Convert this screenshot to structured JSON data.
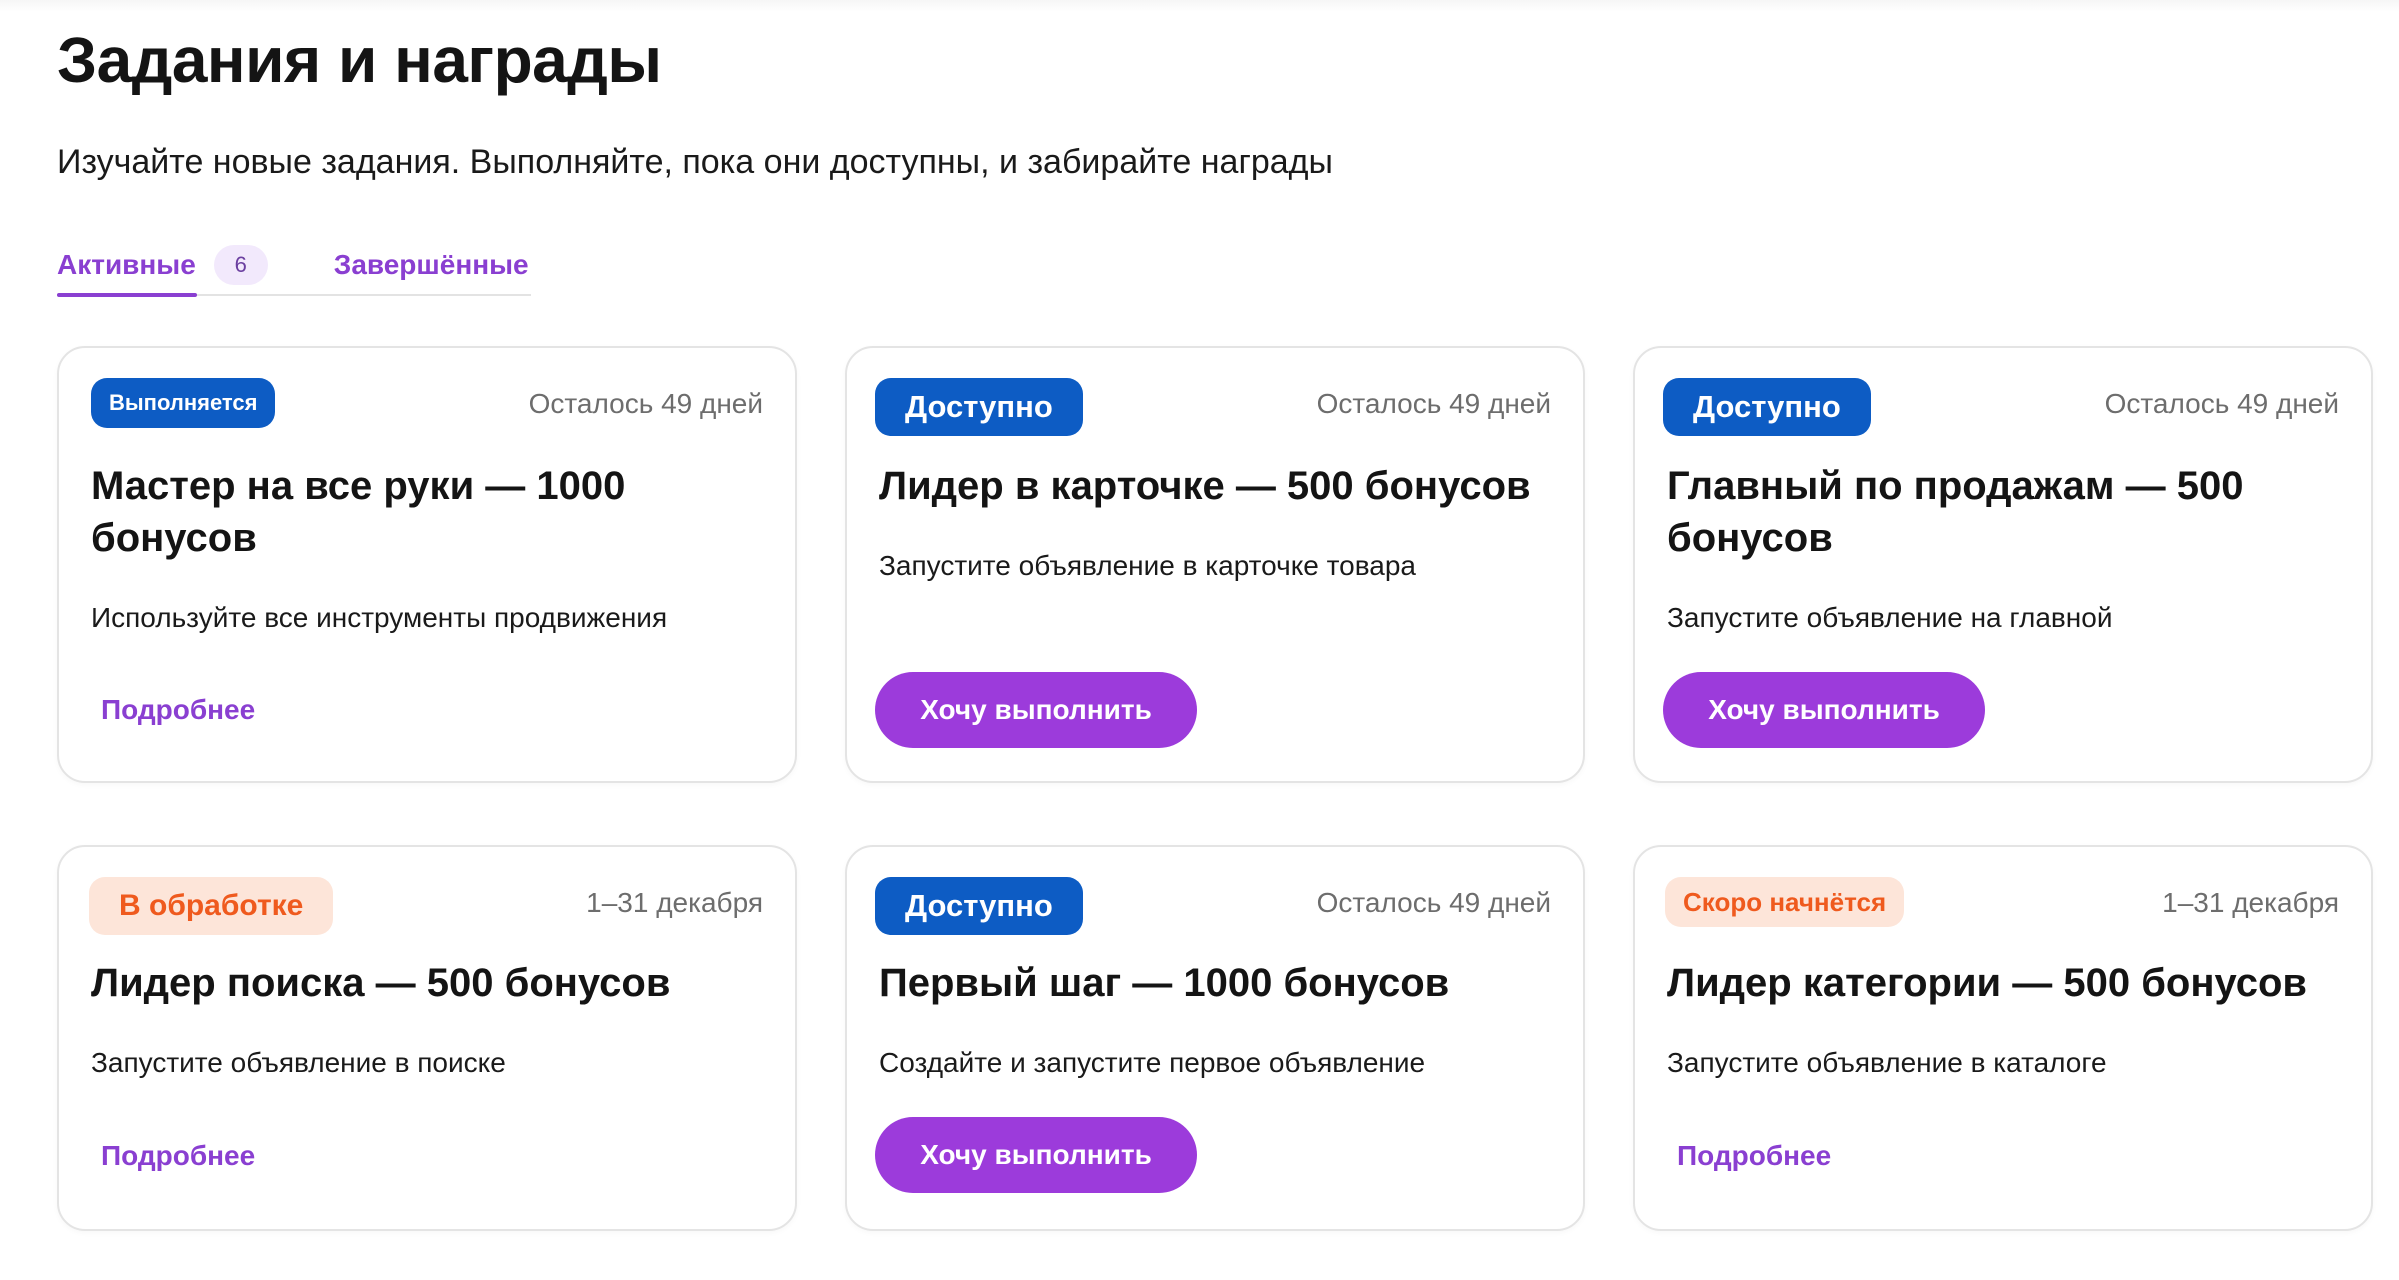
{
  "header": {
    "title": "Задания и награды",
    "subtitle": "Изучайте новые задания. Выполняйте, пока они доступны, и забирайте награды"
  },
  "tabs": [
    {
      "label": "Активные",
      "count": "6",
      "active": true
    },
    {
      "label": "Завершённые",
      "active": false
    }
  ],
  "colors": {
    "accent": "#8a3fd1",
    "button": "#9c3bdb",
    "badge_blue": "#0d5cc4",
    "badge_orange_bg": "#fde5d9",
    "badge_orange_text": "#ef5a1e"
  },
  "cards": [
    {
      "badge": "Выполняется",
      "deadline": "Осталось 49 дней",
      "title": "Мастер на все руки — 1000 бонусов",
      "description": "Используйте все инструменты продвижения",
      "action": "Подробнее"
    },
    {
      "badge": "Доступно",
      "deadline": "Осталось 49 дней",
      "title": "Лидер в карточке — 500 бонусов",
      "description": "Запустите объявление в карточке товара",
      "action": "Хочу выполнить"
    },
    {
      "badge": "Доступно",
      "deadline": "Осталось 49 дней",
      "title": "Главный по продажам — 500 бонусов",
      "description": "Запустите объявление на главной",
      "action": "Хочу выполнить"
    },
    {
      "badge": "В обработке",
      "deadline": "1–31 декабря",
      "title": "Лидер поиска — 500 бонусов",
      "description": "Запустите объявление в поиске",
      "action": "Подробнее"
    },
    {
      "badge": "Доступно",
      "deadline": "Осталось 49 дней",
      "title": "Первый шаг — 1000 бонусов",
      "description": "Создайте и запустите первое объявление",
      "action": "Хочу выполнить"
    },
    {
      "badge": "Скоро начнётся",
      "deadline": "1–31 декабря",
      "title": "Лидер категории — 500 бонусов",
      "description": "Запустите объявление в каталоге",
      "action": "Подробнее"
    }
  ]
}
